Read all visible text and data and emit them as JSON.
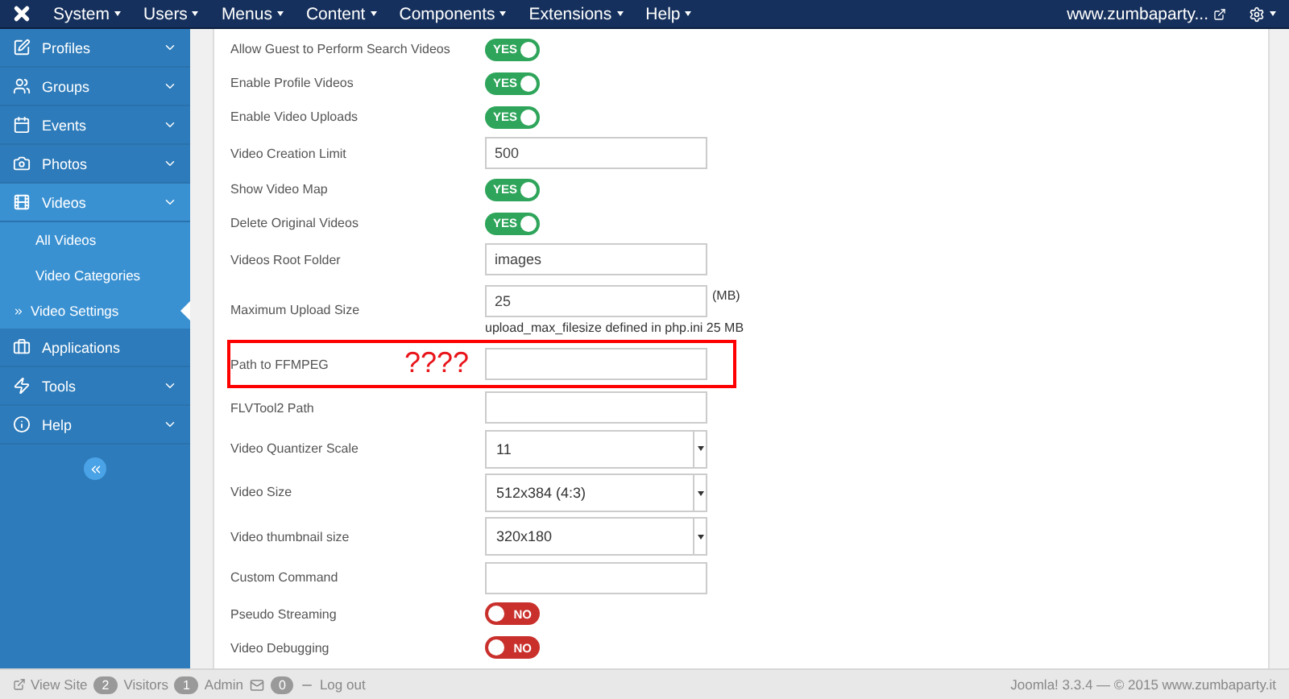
{
  "top_menu": {
    "items": [
      {
        "label": "System"
      },
      {
        "label": "Users"
      },
      {
        "label": "Menus"
      },
      {
        "label": "Content"
      },
      {
        "label": "Components"
      },
      {
        "label": "Extensions"
      },
      {
        "label": "Help"
      }
    ],
    "site_link": "www.zumbaparty..."
  },
  "sidebar": {
    "items": [
      {
        "label": "Profiles",
        "selected": false
      },
      {
        "label": "Groups",
        "selected": false
      },
      {
        "label": "Events",
        "selected": false
      },
      {
        "label": "Photos",
        "selected": false
      },
      {
        "label": "Videos",
        "selected": true,
        "children": [
          {
            "label": "All Videos",
            "selected": false
          },
          {
            "label": "Video Categories",
            "selected": false
          },
          {
            "label": "Video Settings",
            "selected": true
          }
        ]
      },
      {
        "label": "Applications",
        "selected": false
      },
      {
        "label": "Tools",
        "selected": false
      },
      {
        "label": "Help",
        "selected": false
      }
    ]
  },
  "settings": [
    {
      "kind": "toggle",
      "label": "Allow Guest to Perform Search Videos",
      "on": true,
      "text": "YES"
    },
    {
      "kind": "toggle",
      "label": "Enable Profile Videos",
      "on": true,
      "text": "YES"
    },
    {
      "kind": "toggle",
      "label": "Enable Video Uploads",
      "on": true,
      "text": "YES"
    },
    {
      "kind": "input",
      "label": "Video Creation Limit",
      "value": "500"
    },
    {
      "kind": "toggle",
      "label": "Show Video Map",
      "on": true,
      "text": "YES"
    },
    {
      "kind": "toggle",
      "label": "Delete Original Videos",
      "on": true,
      "text": "YES"
    },
    {
      "kind": "input",
      "label": "Videos Root Folder",
      "value": "images"
    },
    {
      "kind": "input",
      "label": "Maximum Upload Size",
      "value": "25",
      "unit": "(MB)",
      "note": "upload_max_filesize defined in php.ini 25 MB"
    },
    {
      "kind": "input",
      "label": "Path to FFMPEG",
      "highlighted": true,
      "annotation": "????"
    },
    {
      "kind": "input",
      "label": "FLVTool2 Path"
    },
    {
      "kind": "select",
      "label": "Video Quantizer Scale",
      "value": "11"
    },
    {
      "kind": "select",
      "label": "Video Size",
      "value": "512x384 (4:3)"
    },
    {
      "kind": "select",
      "label": "Video thumbnail size",
      "value": "320x180"
    },
    {
      "kind": "input",
      "label": "Custom Command"
    },
    {
      "kind": "toggle",
      "label": "Pseudo Streaming",
      "on": false,
      "text": "NO"
    },
    {
      "kind": "toggle",
      "label": "Video Debugging",
      "on": false,
      "text": "NO"
    }
  ],
  "status_bar": {
    "view_site": "View Site",
    "visitors_count": "2",
    "visitors": "Visitors",
    "admin_count": "1",
    "admin": "Admin",
    "messages_count": "0",
    "logout": "Log out",
    "version": "Joomla! 3.3.4 — © 2015 www.zumbaparty.it"
  }
}
